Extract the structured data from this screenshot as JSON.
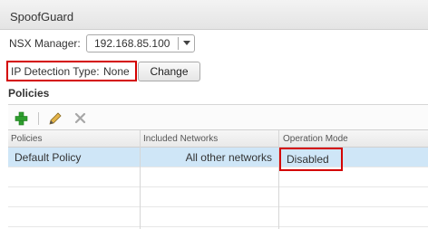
{
  "panel": {
    "title": "SpoofGuard"
  },
  "nsx_manager": {
    "label": "NSX Manager:",
    "selected": "192.168.85.100"
  },
  "ip_detection": {
    "label": "IP Detection Type:",
    "value": "None",
    "change_label": "Change"
  },
  "policies_section": {
    "title": "Policies"
  },
  "toolbar": {
    "add_icon": "plus-icon",
    "edit_icon": "pencil-icon",
    "delete_icon": "x-icon"
  },
  "grid": {
    "columns": [
      "Policies",
      "Included Networks",
      "Operation Mode"
    ],
    "rows": [
      {
        "policy": "Default Policy",
        "networks": "All other networks",
        "mode": "Disabled",
        "selected": true
      }
    ]
  },
  "colors": {
    "highlight": "#d40000",
    "selection": "#cfe6f7",
    "add_green": "#2e9e2e"
  }
}
